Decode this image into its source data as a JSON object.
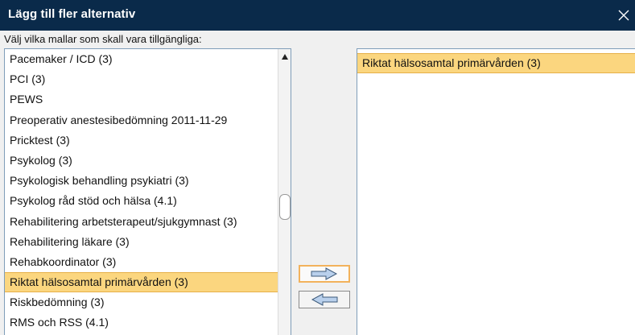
{
  "dialog": {
    "title": "Lägg till fler alternativ",
    "instruction": "Välj vilka mallar som skall vara tillgängliga:"
  },
  "colors": {
    "titlebar": "#0a2a4a",
    "selection": "#fbd67f",
    "selection_border": "#e6b048",
    "focus_border": "#f2b25c",
    "arrow_fill": "#b9d0ec"
  },
  "icons": {
    "close": "close-icon",
    "scroll_up": "scroll-up-arrow-icon",
    "add": "arrow-right-icon",
    "remove": "arrow-left-icon"
  },
  "available_list": {
    "items": [
      "Pacemaker / ICD (3)",
      "PCI (3)",
      "PEWS",
      "Preoperativ anestesibedömning 2011-11-29",
      "Pricktest (3)",
      "Psykolog (3)",
      "Psykologisk behandling psykiatri (3)",
      "Psykolog råd stöd och hälsa (4.1)",
      "Rehabilitering arbetsterapeut/sjukgymnast (3)",
      "Rehabilitering läkare (3)",
      "Rehabkoordinator (3)",
      "Riktat hälsosamtal primärvården (3)",
      "Riskbedömning (3)",
      "RMS och RSS (4.1)"
    ],
    "selected_index": 11
  },
  "selected_list": {
    "items": [
      "Riktat hälsosamtal primärvården (3)"
    ],
    "selected_index": 0
  }
}
